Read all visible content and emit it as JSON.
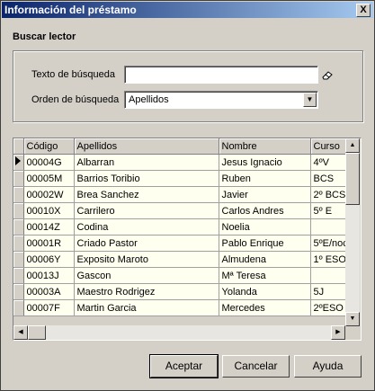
{
  "window": {
    "title": "Información del préstamo",
    "close_symbol": "X"
  },
  "search": {
    "section_title": "Buscar lector",
    "text_label": "Texto de búsqueda",
    "text_value": "",
    "order_label": "Orden de búsqueda",
    "order_value": "Apellidos"
  },
  "grid": {
    "columns": [
      "Código",
      "Apellidos",
      "Nombre",
      "Curso"
    ],
    "rows": [
      [
        "00004G",
        "Albarran",
        "Jesus Ignacio",
        "4ºV"
      ],
      [
        "00005M",
        "Barrios Toribio",
        "Ruben",
        "BCS"
      ],
      [
        "00002W",
        "Brea Sanchez",
        "Javier",
        "2º BCS"
      ],
      [
        "00010X",
        "Carrilero",
        "Carlos Andres",
        "5º E"
      ],
      [
        "00014Z",
        "Codina",
        "Noelia",
        ""
      ],
      [
        "00001R",
        "Criado Pastor",
        "Pablo Enrique",
        "5ºE/noc"
      ],
      [
        "00006Y",
        "Exposito Maroto",
        "Almudena",
        "1º ESO"
      ],
      [
        "00013J",
        "Gascon",
        "Mª Teresa",
        ""
      ],
      [
        "00003A",
        "Maestro Rodrigez",
        "Yolanda",
        "5J"
      ],
      [
        "00007F",
        "Martin Garcia",
        "Mercedes",
        "2ºESO"
      ]
    ],
    "selected_row": 0
  },
  "buttons": {
    "accept": "Aceptar",
    "cancel": "Cancelar",
    "help": "Ayuda"
  }
}
